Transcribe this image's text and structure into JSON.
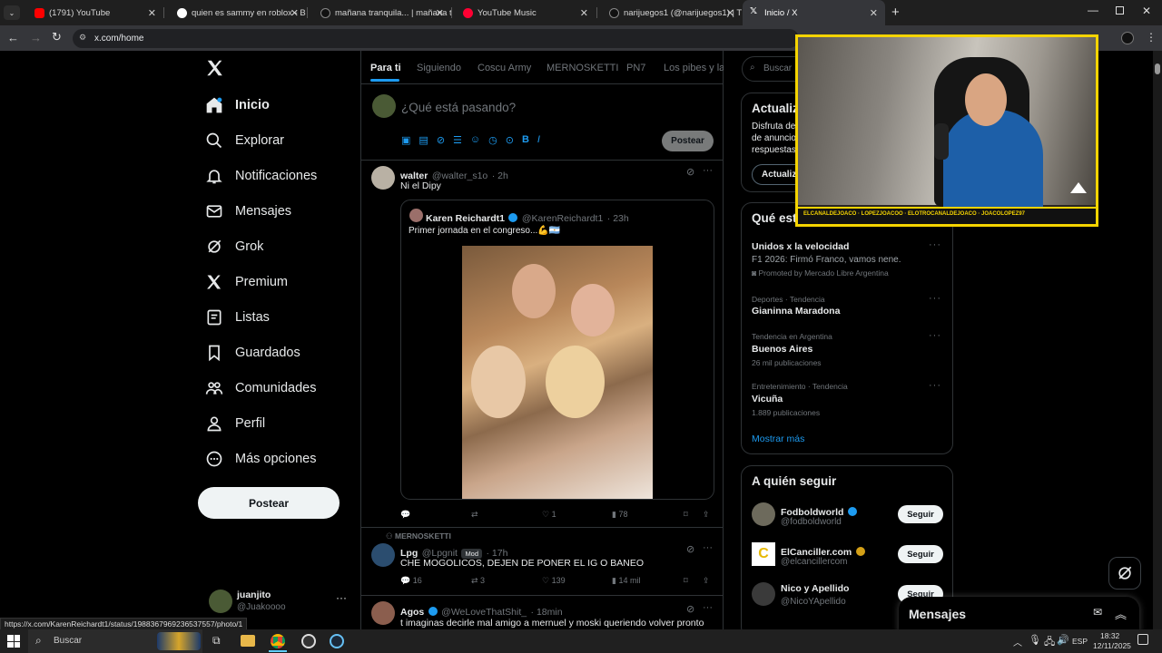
{
  "browser": {
    "tabs": [
      {
        "title": "(1791) YouTube",
        "color": "#ff0000"
      },
      {
        "title": "quien es sammy en roblox - Bu",
        "color": "#e8eaed"
      },
      {
        "title": "mañana tranquila... | mañana t",
        "color": "#e8eaed"
      },
      {
        "title": "YouTube Music",
        "color": "#ff0033"
      },
      {
        "title": "narijuegos1 (@narijuegos1) | Ti",
        "color": "#e8eaed"
      },
      {
        "title": "Inicio / X",
        "color": "#e8eaed"
      }
    ],
    "url": "x.com/home",
    "status_url": "https://x.com/KarenReichardt1/status/1988367969236537557/photo/1"
  },
  "nav": {
    "items": [
      "Inicio",
      "Explorar",
      "Notificaciones",
      "Mensajes",
      "Grok",
      "Premium",
      "Listas",
      "Guardados",
      "Comunidades",
      "Perfil",
      "Más opciones"
    ],
    "post_label": "Postear",
    "user_name": "juanjito",
    "user_handle": "@Juakoooo"
  },
  "timeline": {
    "tabs": [
      "Para ti",
      "Siguiendo",
      "Coscu Army",
      "MERNOSKETTI",
      "PN7",
      "Los pibes y la"
    ],
    "composer_placeholder": "¿Qué está pasando?",
    "composer_post": "Postear",
    "tweets": [
      {
        "name": "walter",
        "handle": "@walter_s1o",
        "time": "· 2h",
        "text": "Ni el Dipy",
        "quote": {
          "name": "Karen Reichardt1",
          "handle": "@KarenReichardt1",
          "time": "· 23h",
          "text": "Primer  jornada en el congreso...💪🇦🇷"
        },
        "likes": "1",
        "views": "78"
      },
      {
        "community": "MERNOSKETTI",
        "name": "Lpg",
        "handle": "@Lpgnit",
        "badge": "Mod",
        "time": "· 17h",
        "text": "CHE MOGOLICOS, DEJEN DE PONER EL IG O BANEO",
        "replies": "16",
        "retweets": "3",
        "likes": "139",
        "views": "14 mil"
      },
      {
        "name": "Agos",
        "handle": "@WeLoveThatShit_",
        "time": "· 18min",
        "text": "t imaginas decirle mal amigo a mernuel y moski queriendo volver pronto"
      }
    ]
  },
  "sidebar": {
    "search_placeholder": "Buscar",
    "premium": {
      "title": "Actualiz",
      "line1": "Disfruta de",
      "line2": "de anuncio",
      "line3": "respuestas.",
      "button": "Actualiz"
    },
    "trends_title": "Qué est",
    "trends": [
      {
        "name": "Unidos x la velocidad",
        "sub": "F1 2026: Firmó Franco, vamos nene.",
        "promo": "Promoted by Mercado Libre Argentina"
      },
      {
        "cat": "Deportes · Tendencia",
        "name": "Gianinna Maradona"
      },
      {
        "cat": "Tendencia en Argentina",
        "name": "Buenos Aires",
        "posts": "26 mil publicaciones"
      },
      {
        "cat": "Entretenimiento · Tendencia",
        "name": "Vicuña",
        "posts": "1.889 publicaciones"
      }
    ],
    "show_more": "Mostrar más",
    "follow_title": "A quién seguir",
    "follow": [
      {
        "name": "Fodboldworld",
        "handle": "@fodboldworld",
        "btn": "Seguir"
      },
      {
        "name": "ElCanciller.com",
        "handle": "@elcancillercom",
        "btn": "Seguir"
      },
      {
        "name": "Nico y Apellido",
        "handle": "@NicoYApellido",
        "btn": "Seguir"
      }
    ],
    "messages": "Mensajes"
  },
  "stream": {
    "ticker": "ELCANALDEJOACO  ·  LOPEZJOACOO  ·  ELOTROCANALDEJOACO  ·  JOACOLOPEZ97"
  },
  "taskbar": {
    "search": "Buscar",
    "lang": "ESP",
    "time": "18:32",
    "date": "12/11/2025"
  }
}
